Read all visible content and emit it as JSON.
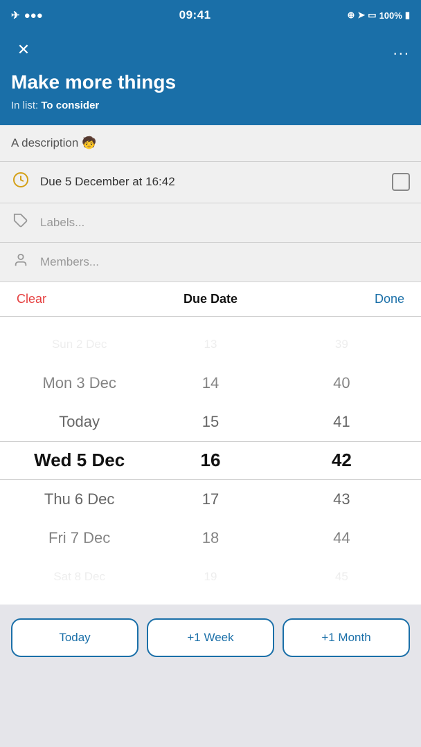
{
  "status_bar": {
    "time": "09:41",
    "signal": "●●●●",
    "battery": "100%",
    "battery_icon": "🔋"
  },
  "header": {
    "close_icon": "✕",
    "more_icon": "...",
    "task_title": "Make more things",
    "list_label": "In list:",
    "list_name": "To consider"
  },
  "description": {
    "text": "A description 🧒"
  },
  "due_row": {
    "icon": "🕐",
    "text": "Due 5 December at 16:42"
  },
  "labels_row": {
    "placeholder": "Labels..."
  },
  "members_row": {
    "placeholder": "Members..."
  },
  "picker": {
    "clear_label": "Clear",
    "title": "Due Date",
    "done_label": "Done",
    "date_column": [
      {
        "label": "Sun 2 Dec",
        "state": "far"
      },
      {
        "label": "Mon 3 Dec",
        "state": "near"
      },
      {
        "label": "Today",
        "state": "near"
      },
      {
        "label": "Wed 5 Dec",
        "state": "selected"
      },
      {
        "label": "Thu 6 Dec",
        "state": "near"
      },
      {
        "label": "Fri 7 Dec",
        "state": "near"
      },
      {
        "label": "Sat 8 Dec",
        "state": "far"
      }
    ],
    "hour_column": [
      {
        "label": "13",
        "state": "far"
      },
      {
        "label": "14",
        "state": "near"
      },
      {
        "label": "15",
        "state": "near"
      },
      {
        "label": "16",
        "state": "selected"
      },
      {
        "label": "17",
        "state": "near"
      },
      {
        "label": "18",
        "state": "near"
      },
      {
        "label": "19",
        "state": "far"
      }
    ],
    "minute_column": [
      {
        "label": "39",
        "state": "far"
      },
      {
        "label": "40",
        "state": "near"
      },
      {
        "label": "41",
        "state": "near"
      },
      {
        "label": "42",
        "state": "selected"
      },
      {
        "label": "43",
        "state": "near"
      },
      {
        "label": "44",
        "state": "near"
      },
      {
        "label": "45",
        "state": "far"
      }
    ]
  },
  "buttons": {
    "today": "Today",
    "week": "+1 Week",
    "month": "+1 Month"
  }
}
